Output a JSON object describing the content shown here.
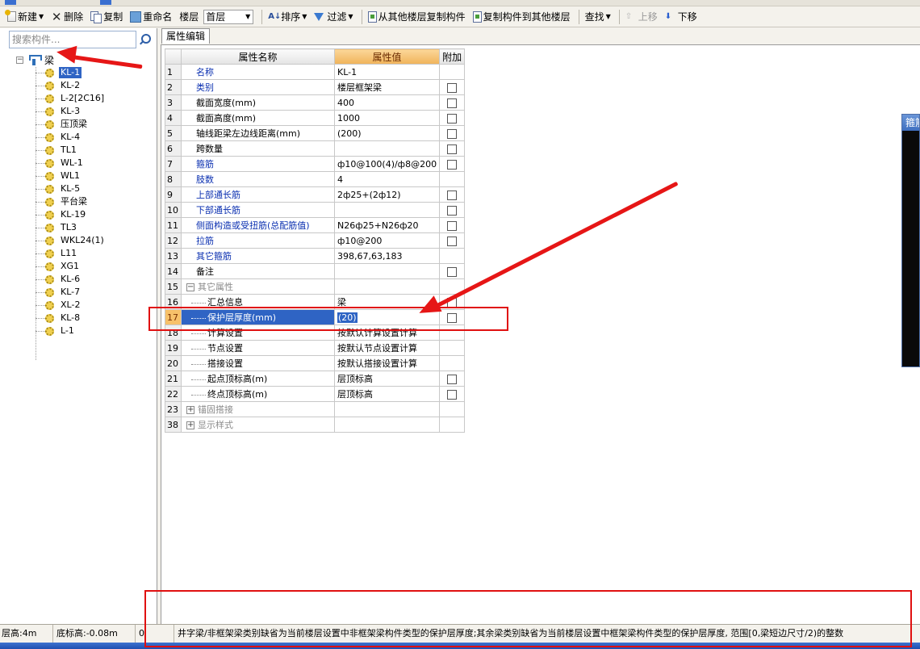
{
  "toolbar": {
    "new_label": "新建",
    "delete_label": "删除",
    "copy_label": "复制",
    "rename_label": "重命名",
    "floor_label": "楼层",
    "floor_value": "首层",
    "sort_label": "排序",
    "filter_label": "过滤",
    "copy_from_label": "从其他楼层复制构件",
    "copy_to_label": "复制构件到其他楼层",
    "find_label": "查找",
    "move_up_label": "上移",
    "move_down_label": "下移"
  },
  "sidebar": {
    "search_placeholder": "搜索构件...",
    "root_label": "梁",
    "items": [
      "KL-1",
      "KL-2",
      "L-2[2C16]",
      "KL-3",
      "压顶梁",
      "KL-4",
      "TL1",
      "WL-1",
      "WL1",
      "KL-5",
      "平台梁",
      "KL-19",
      "TL3",
      "WKL24(1)",
      "L11",
      "XG1",
      "KL-6",
      "KL-7",
      "XL-2",
      "KL-8",
      "L-1"
    ],
    "selected_index": 0
  },
  "main": {
    "tab_label": "属性编辑",
    "columns": {
      "name": "属性名称",
      "value": "属性值",
      "extra": "附加"
    },
    "rows": [
      {
        "num": "1",
        "name": "名称",
        "value": "KL-1",
        "checkbox": false,
        "style": "blue"
      },
      {
        "num": "2",
        "name": "类别",
        "value": "楼层框架梁",
        "checkbox": true,
        "style": "blue"
      },
      {
        "num": "3",
        "name": "截面宽度(mm)",
        "value": "400",
        "checkbox": true,
        "style": "black"
      },
      {
        "num": "4",
        "name": "截面高度(mm)",
        "value": "1000",
        "checkbox": true,
        "style": "black"
      },
      {
        "num": "5",
        "name": "轴线距梁左边线距离(mm)",
        "value": "(200)",
        "checkbox": true,
        "style": "black"
      },
      {
        "num": "6",
        "name": "跨数量",
        "value": "",
        "checkbox": true,
        "style": "black"
      },
      {
        "num": "7",
        "name": "箍筋",
        "value": "ф10@100(4)/ф8@200",
        "checkbox": true,
        "style": "blue"
      },
      {
        "num": "8",
        "name": "肢数",
        "value": "4",
        "checkbox": false,
        "style": "blue"
      },
      {
        "num": "9",
        "name": "上部通长筋",
        "value": "2ф25+(2ф12)",
        "checkbox": true,
        "style": "blue"
      },
      {
        "num": "10",
        "name": "下部通长筋",
        "value": "",
        "checkbox": true,
        "style": "blue"
      },
      {
        "num": "11",
        "name": "侧面构造或受扭筋(总配筋值)",
        "value": "N26ф25+N26ф20",
        "checkbox": true,
        "style": "blue"
      },
      {
        "num": "12",
        "name": "拉筋",
        "value": "ф10@200",
        "checkbox": true,
        "style": "blue"
      },
      {
        "num": "13",
        "name": "其它箍筋",
        "value": "398,67,63,183",
        "checkbox": false,
        "style": "blue"
      },
      {
        "num": "14",
        "name": "备注",
        "value": "",
        "checkbox": true,
        "style": "black"
      },
      {
        "num": "15",
        "name": "其它属性",
        "value": "",
        "checkbox": false,
        "style": "group-open"
      },
      {
        "num": "16",
        "name": "汇总信息",
        "value": "梁",
        "checkbox": true,
        "style": "sub"
      },
      {
        "num": "17",
        "name": "保护层厚度(mm)",
        "value": "(20)",
        "checkbox": true,
        "style": "sub-selected"
      },
      {
        "num": "18",
        "name": "计算设置",
        "value": "按默认计算设置计算",
        "checkbox": false,
        "style": "sub"
      },
      {
        "num": "19",
        "name": "节点设置",
        "value": "按默认节点设置计算",
        "checkbox": false,
        "style": "sub"
      },
      {
        "num": "20",
        "name": "搭接设置",
        "value": "按默认搭接设置计算",
        "checkbox": false,
        "style": "sub"
      },
      {
        "num": "21",
        "name": "起点顶标高(m)",
        "value": "层顶标高",
        "checkbox": true,
        "style": "sub"
      },
      {
        "num": "22",
        "name": "终点顶标高(m)",
        "value": "层顶标高",
        "checkbox": true,
        "style": "sub-last"
      },
      {
        "num": "23",
        "name": "锚固搭接",
        "value": "",
        "checkbox": false,
        "style": "group-closed"
      },
      {
        "num": "38",
        "name": "显示样式",
        "value": "",
        "checkbox": false,
        "style": "group-closed"
      }
    ]
  },
  "side_panel": {
    "title": "箍筋"
  },
  "statusbar": {
    "floor_height": "层高:4m",
    "bottom_elevation": "底标高:-0.08m",
    "value": "0",
    "hint": "井字梁/非框架梁类别缺省为当前楼层设置中非框架梁构件类型的保护层厚度;其余梁类别缺省为当前楼层设置中框架梁构件类型的保护层厚度, 范围[0,梁短边尺寸/2)的整数"
  },
  "colors": {
    "selection_blue": "#2f64c4",
    "header_orange": "#f0b35a",
    "annotation_red": "#e01010",
    "property_blue": "#0a2fb0"
  }
}
